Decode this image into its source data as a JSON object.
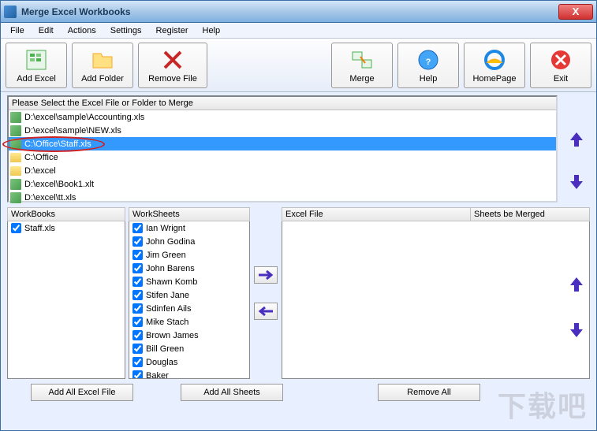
{
  "window": {
    "title": "Merge Excel Workbooks"
  },
  "menu": {
    "file": "File",
    "edit": "Edit",
    "actions": "Actions",
    "settings": "Settings",
    "register": "Register",
    "help": "Help"
  },
  "toolbar": {
    "addExcel": "Add Excel",
    "addFolder": "Add Folder",
    "removeFile": "Remove File",
    "merge": "Merge",
    "help": "Help",
    "homePage": "HomePage",
    "exit": "Exit"
  },
  "filePanel": {
    "header": "Please Select the Excel File or Folder to Merge",
    "items": [
      {
        "type": "xls",
        "path": "D:\\excel\\sample\\Accounting.xls"
      },
      {
        "type": "xls",
        "path": "D:\\excel\\sample\\NEW.xls"
      },
      {
        "type": "xls",
        "path": "C:\\Office\\Staff.xls",
        "selected": true,
        "circled": true
      },
      {
        "type": "folder",
        "path": "C:\\Office"
      },
      {
        "type": "folder",
        "path": "D:\\excel"
      },
      {
        "type": "xls",
        "path": "D:\\excel\\Book1.xlt"
      },
      {
        "type": "xls",
        "path": "D:\\excel\\tt.xls"
      }
    ]
  },
  "workbooks": {
    "header": "WorkBooks",
    "items": [
      "Staff.xls"
    ]
  },
  "worksheets": {
    "header": "WorkSheets",
    "items": [
      "Ian Wrignt",
      "John Godina",
      "Jim Green",
      "John Barens",
      "Shawn Komb",
      "Stifen Jane",
      "Sdinfen Ails",
      "Mike Stach",
      "Brown James",
      "Bill Green",
      "Douglas",
      "Baker"
    ]
  },
  "result": {
    "col1": "Excel File",
    "col2": "Sheets be Merged"
  },
  "buttons": {
    "addAllExcel": "Add All Excel File",
    "addAllSheets": "Add All Sheets",
    "removeAll": "Remove All"
  },
  "watermark": "下载吧"
}
